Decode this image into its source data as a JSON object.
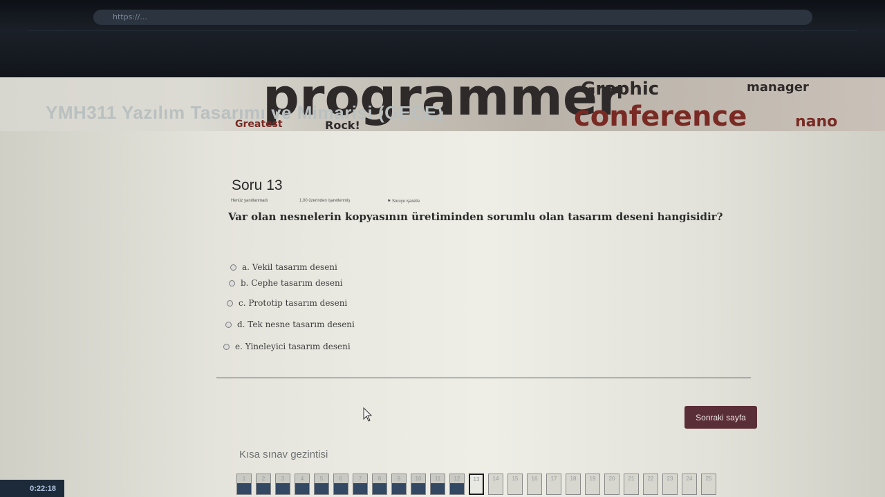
{
  "browser": {
    "address": "https://..."
  },
  "course": {
    "breadcrumb": "",
    "title": "YMH311 Yazılım Tasarımı ve Mimarisi (GECE)"
  },
  "question": {
    "title": "Soru 13",
    "meta": [
      "Henüz yanıtlanmadı",
      "1,00 üzerinden işaretlenmiş",
      "Soruyu işaretle"
    ],
    "text": "Var olan nesnelerin kopyasının üretiminden sorumlu olan tasarım deseni hangisidir?",
    "options": [
      "a. Vekil tasarım deseni",
      "b. Cephe tasarım deseni",
      "c. Prototip tasarım deseni",
      "d. Tek nesne tasarım deseni",
      "e. Yineleyici tasarım deseni"
    ]
  },
  "next_button": "Sonraki sayfa",
  "navigation": {
    "title": "Kısa sınav gezintisi",
    "items": [
      "1",
      "2",
      "3",
      "4",
      "5",
      "6",
      "7",
      "8",
      "9",
      "10",
      "11",
      "12",
      "13",
      "14",
      "15",
      "16",
      "17",
      "18",
      "19",
      "20",
      "21",
      "22",
      "23",
      "24",
      "25"
    ],
    "answered_count": 12,
    "current": 13
  },
  "timer": "0:22:18",
  "colors": {
    "next_button": "#5a2e36",
    "answered": "#324863"
  }
}
